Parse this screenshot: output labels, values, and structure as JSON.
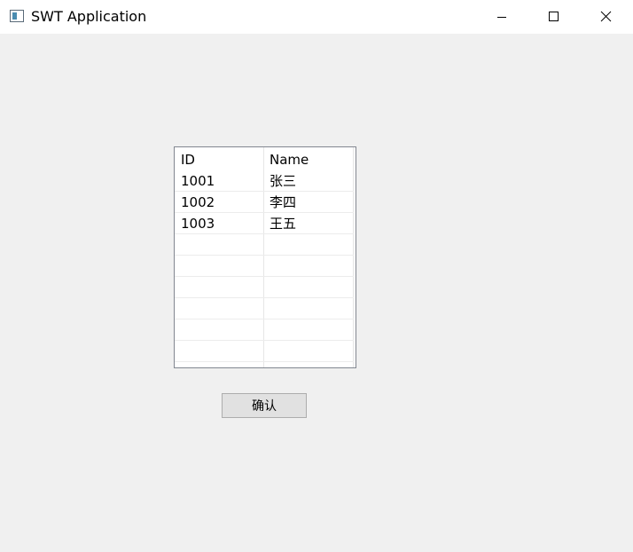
{
  "window": {
    "title": "SWT Application",
    "icon": "app-window-icon",
    "controls": {
      "minimize_icon": "minimize-icon",
      "maximize_icon": "maximize-icon",
      "close_icon": "close-icon"
    }
  },
  "table": {
    "columns": [
      "ID",
      "Name"
    ],
    "rows": [
      [
        "1001",
        "张三"
      ],
      [
        "1002",
        "李四"
      ],
      [
        "1003",
        "王五"
      ],
      [
        "",
        ""
      ],
      [
        "",
        ""
      ],
      [
        "",
        ""
      ],
      [
        "",
        ""
      ],
      [
        "",
        ""
      ],
      [
        "",
        ""
      ]
    ]
  },
  "confirm_button": {
    "label": "确认"
  },
  "colors": {
    "background": "#f0f0f0",
    "titlebar": "#ffffff",
    "table_border": "#828790",
    "button_face": "#e1e1e1",
    "button_border": "#adadad"
  }
}
